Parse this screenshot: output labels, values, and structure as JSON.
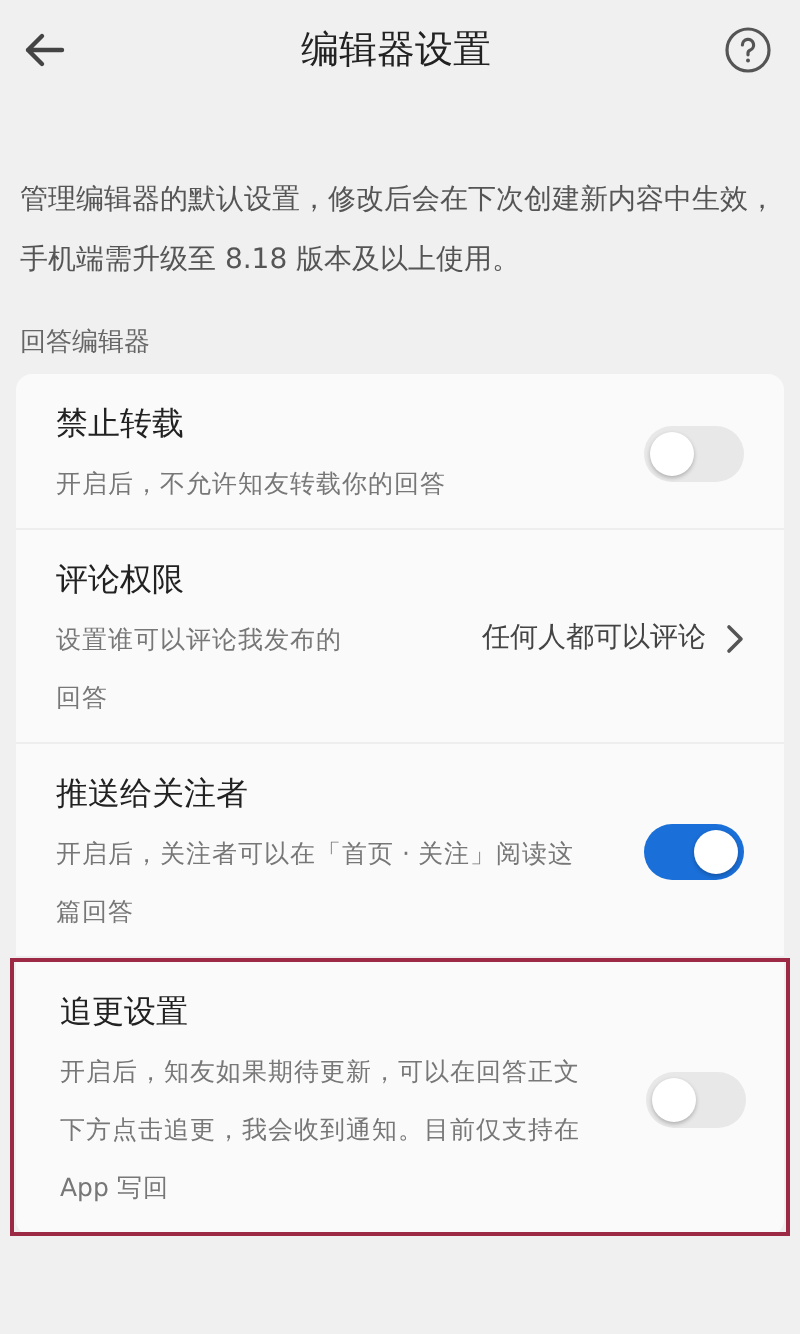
{
  "header": {
    "title": "编辑器设置"
  },
  "description": "管理编辑器的默认设置，修改后会在下次创建新内容中生效，手机端需升级至 8.18 版本及以上使用。",
  "section": {
    "label": "回答编辑器",
    "rows": [
      {
        "kind": "toggle",
        "title": "禁止转载",
        "subtitle": "开启后，不允许知友转载你的回答",
        "on": false,
        "highlighted": false
      },
      {
        "kind": "link",
        "title": "评论权限",
        "subtitle": "设置谁可以评论我发布的回答",
        "value": "任何人都可以评论",
        "highlighted": false
      },
      {
        "kind": "toggle",
        "title": "推送给关注者",
        "subtitle": "开启后，关注者可以在「首页 · 关注」阅读这篇回答",
        "on": true,
        "highlighted": false
      },
      {
        "kind": "toggle",
        "title": "追更设置",
        "subtitle": "开启后，知友如果期待更新，可以在回答正文下方点击追更，我会收到通知。目前仅支持在 App 写回",
        "on": false,
        "highlighted": true
      }
    ]
  }
}
